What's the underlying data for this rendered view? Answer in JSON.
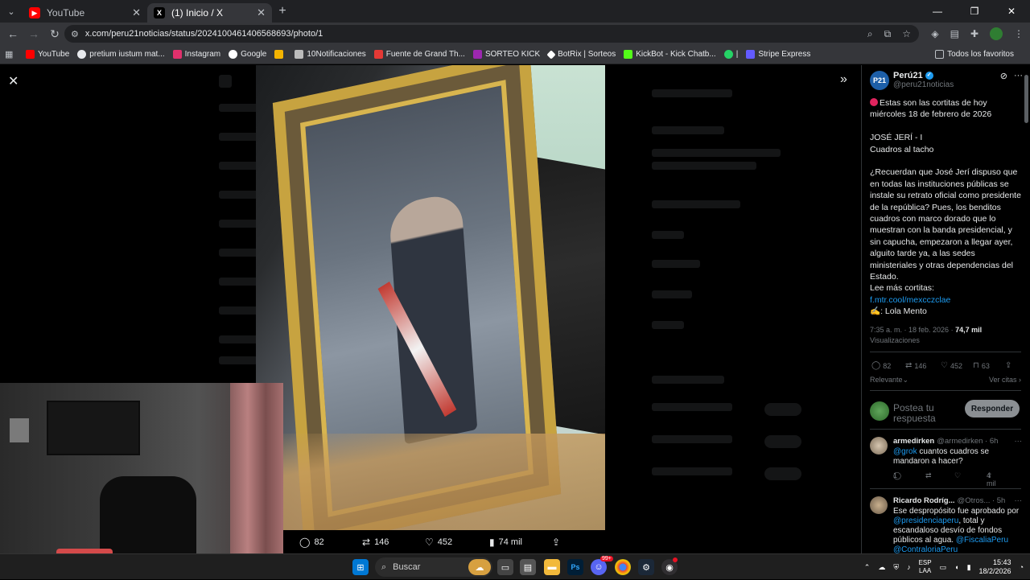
{
  "browser": {
    "tabs": [
      {
        "label": "YouTube",
        "active": false
      },
      {
        "label": "(1) Inicio / X",
        "active": true
      }
    ],
    "url": "x.com/peru21noticias/status/2024100461406568693/photo/1",
    "bookmarks": [
      {
        "label": "YouTube",
        "color": "#ff0000"
      },
      {
        "label": "pretium iustum mat...",
        "color": "#e8eaed"
      },
      {
        "label": "Instagram",
        "color": "#e1306c"
      },
      {
        "label": "Google",
        "color": "#4285f4"
      },
      {
        "label": "",
        "color": "#f4b400"
      },
      {
        "label": "10Notificaciones",
        "color": "#e8eaed"
      },
      {
        "label": "Fuente de Grand Th...",
        "color": "#e53935"
      },
      {
        "label": "SORTEO KICK",
        "color": "#9c27b0"
      },
      {
        "label": "BotRix | Sorteos",
        "color": "#ffffff"
      },
      {
        "label": "KickBot - Kick Chatb...",
        "color": "#53fc18"
      },
      {
        "label": "|",
        "color": "#25d366"
      },
      {
        "label": "Stripe Express",
        "color": "#635bff"
      }
    ],
    "all_bookmarks": "Todos los favoritos"
  },
  "viewer": {
    "actions": {
      "replies": "82",
      "reposts": "146",
      "likes": "452",
      "views": "74 mil"
    }
  },
  "sidebar": {
    "account_name": "Perú21",
    "account_handle": "@peru21noticias",
    "logo_text": "P21",
    "post_lines": {
      "l1": "Estas son las cortitas de hoy miércoles 18 de febrero de 2026",
      "l2": "JOSÉ JERÍ - I",
      "l3": "Cuadros al tacho",
      "l4": "¿Recuerdan que José Jerí dispuso que en todas las instituciones públicas se instale su retrato oficial como presidente de la república? Pues, los benditos cuadros con marco dorado que lo muestran con la banda presidencial, y sin capucha, empezaron a llegar ayer, alguito tarde ya, a las sedes ministeriales y otras dependencias del Estado.",
      "l5": "Lee más cortitas:",
      "link": "f.mtr.cool/mexcczclae",
      "author": ": Lola Mento"
    },
    "meta_time": "7:35 a. m. · 18 feb. 2026 · ",
    "meta_views": "74,7 mil",
    "meta_views_label": "Visualizaciones",
    "stats": {
      "replies": "82",
      "reposts": "146",
      "likes": "452",
      "bookmarks": "63"
    },
    "sort_label": "Relevante",
    "quotes_label": "Ver citas",
    "reply_placeholder": "Postea tu respuesta",
    "reply_button": "Responder",
    "replies": [
      {
        "name": "armedirken",
        "handle": "@armedirken · 6h",
        "mention": "@grok",
        "text": " cuantos cuadros se mandaron a hacer?",
        "replies": "1",
        "views": "4 mil"
      },
      {
        "name": "Ricardo Rodríg...",
        "handle": "@Otros... · 5h",
        "text1": "Ese despropósito fue aprobado por ",
        "mention1": "@presidenciaperu",
        "text2": ", total y escandaloso desvío de fondos públicos al agua.",
        "mention2": "@FiscaliaPeru @ContraloriaPeru"
      }
    ]
  },
  "taskbar": {
    "search_placeholder": "Buscar",
    "lang1": "ESP",
    "lang2": "LAA",
    "time": "15:43",
    "date": "18/2/2026",
    "badge": "99+"
  }
}
